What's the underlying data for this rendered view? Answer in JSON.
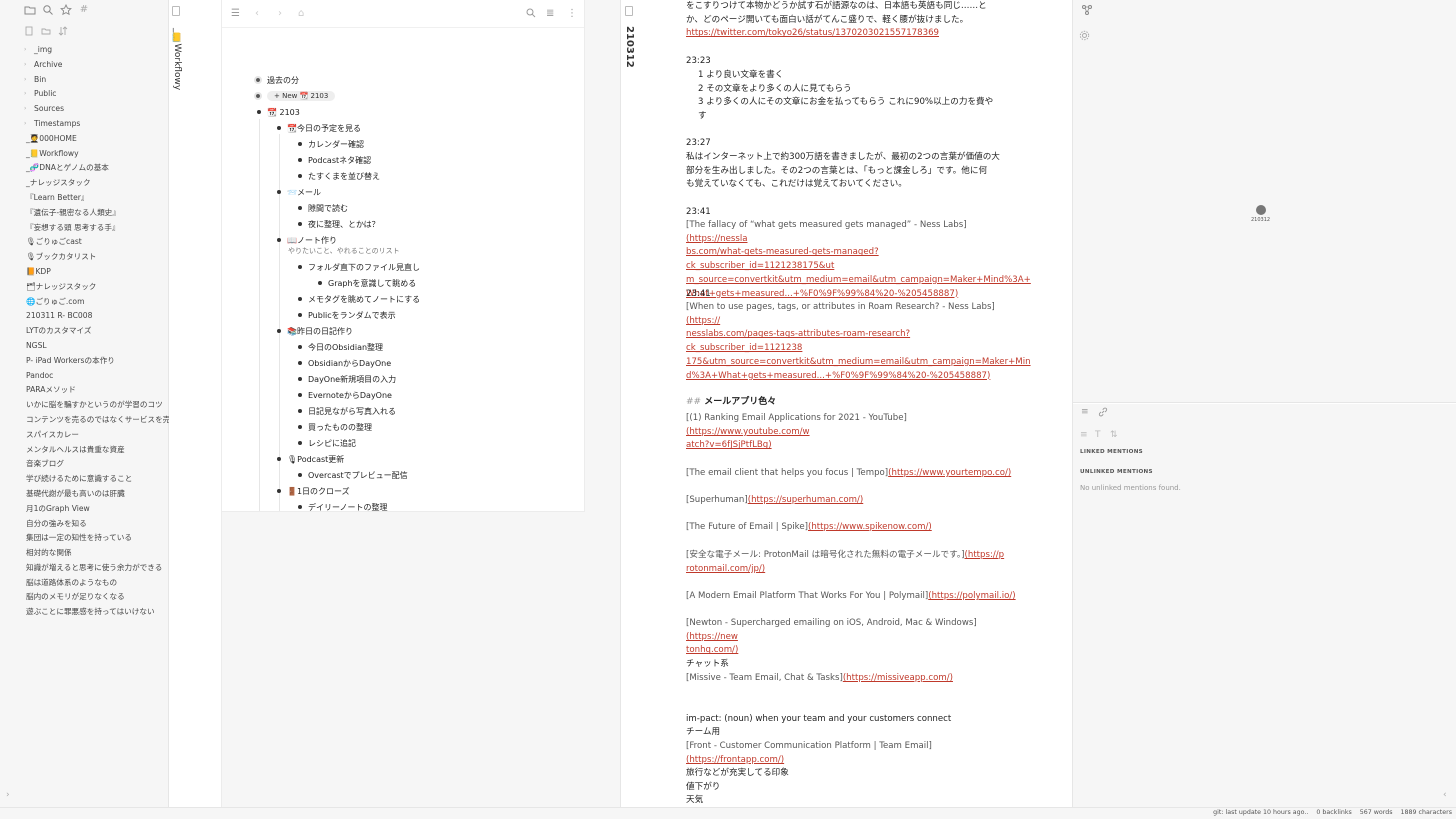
{
  "sidebar": {
    "toolbar_icons": [
      "folder-icon",
      "search-icon",
      "star-icon",
      "tag-icon"
    ],
    "files": [
      {
        "label": "_img",
        "folder": true
      },
      {
        "label": "Archive",
        "folder": true
      },
      {
        "label": "Bin",
        "folder": true
      },
      {
        "label": "Public",
        "folder": true
      },
      {
        "label": "Sources",
        "folder": true
      },
      {
        "label": "Timestamps",
        "folder": true
      },
      {
        "label": "_🧑‍🎓000HOME",
        "folder": false
      },
      {
        "label": "_📒Workflowy",
        "folder": false
      },
      {
        "label": "_🧬DNAとゲノムの基本",
        "folder": false
      },
      {
        "label": "_ナレッジスタック",
        "folder": false
      },
      {
        "label": "『Learn Better』",
        "folder": false
      },
      {
        "label": "『遺伝子-親密なる人類史』",
        "folder": false
      },
      {
        "label": "『妄想する頭 思考する手』",
        "folder": false
      },
      {
        "label": "🎙ごりゅごcast",
        "folder": false
      },
      {
        "label": "🎙ブックカタリスト",
        "folder": false
      },
      {
        "label": "📙KDP",
        "folder": false
      },
      {
        "label": "🗂ナレッジスタック",
        "folder": false
      },
      {
        "label": "🌐ごりゅご.com",
        "folder": false
      },
      {
        "label": "210311 R- BC008",
        "folder": false
      },
      {
        "label": "LYTのカスタマイズ",
        "folder": false
      },
      {
        "label": "NGSL",
        "folder": false
      },
      {
        "label": "P- iPad Workersの本作り",
        "folder": false
      },
      {
        "label": "Pandoc",
        "folder": false
      },
      {
        "label": "PARAメソッド",
        "folder": false
      },
      {
        "label": "いかに脳を騙すかというのが学習のコツ",
        "folder": false
      },
      {
        "label": "コンテンツを売るのではなくサービスを売る",
        "folder": false
      },
      {
        "label": "スパイスカレー",
        "folder": false
      },
      {
        "label": "メンタルヘルスは貴重な資産",
        "folder": false
      },
      {
        "label": "音楽ブログ",
        "folder": false
      },
      {
        "label": "学び続けるために意識すること",
        "folder": false
      },
      {
        "label": "基礎代謝が最も高いのは肝臓",
        "folder": false
      },
      {
        "label": "月1のGraph View",
        "folder": false
      },
      {
        "label": "自分の強みを知る",
        "folder": false
      },
      {
        "label": "集団は一定の知性を持っている",
        "folder": false
      },
      {
        "label": "相対的な関係",
        "folder": false
      },
      {
        "label": "知識が増えると思考に使う余力ができる",
        "folder": false
      },
      {
        "label": "脳は道路体系のようなもの",
        "folder": false
      },
      {
        "label": "脳内のメモリが足りなくなる",
        "folder": false
      },
      {
        "label": "遊ぶことに罪悪感を持ってはいけない",
        "folder": false
      }
    ]
  },
  "ribbon_title": "_📒Workflowy",
  "outliner": {
    "root1": "過去の分",
    "new_button": "+ New 📆 2103",
    "root2": "📆 2103",
    "items": [
      {
        "text": "📆今日の予定を見る",
        "level": 1
      },
      {
        "text": "カレンダー確認",
        "level": 2
      },
      {
        "text": "Podcastネタ確認",
        "level": 2
      },
      {
        "text": "たすくまを並び替え",
        "level": 2
      },
      {
        "text": "📨メール",
        "level": 1
      },
      {
        "text": "隙間で読む",
        "level": 2
      },
      {
        "text": "夜に整理、とかは？",
        "level": 2
      },
      {
        "text": "📖ノート作り",
        "level": 1,
        "note": "やりたいこと、やれることのリスト"
      },
      {
        "text": "フォルダ直下のファイル見直し",
        "level": 2
      },
      {
        "text": "Graphを意識して眺める",
        "level": 3
      },
      {
        "text": "メモタグを眺めてノートにする",
        "level": 2
      },
      {
        "text": "Publicをランダムで表示",
        "level": 2
      },
      {
        "text": "📚昨日の日記作り",
        "level": 1
      },
      {
        "text": "今日のObsidian整理",
        "level": 2
      },
      {
        "text": "ObsidianからDayOne",
        "level": 2
      },
      {
        "text": "DayOne新規項目の入力",
        "level": 2
      },
      {
        "text": "EvernoteからDayOne",
        "level": 2
      },
      {
        "text": "日記見ながら写真入れる",
        "level": 2
      },
      {
        "text": "買ったものの整理",
        "level": 2
      },
      {
        "text": "レシピに追記",
        "level": 2
      },
      {
        "text": "🎙Podcast更新",
        "level": 1
      },
      {
        "text": "Overcastでプレビュー配信",
        "level": 2
      },
      {
        "text": "🚪1日のクローズ",
        "level": 1
      },
      {
        "text": "デイリーノートの整理",
        "level": 2
      }
    ]
  },
  "note": {
    "title": "210312",
    "p1_line1": "をこすりつけて本物かどうか試す石が語源なのは、日本語も英語も同じ……と",
    "p1_line2": "か、どのページ開いても面白い話がてんこ盛りで、軽く腰が抜けました。",
    "p1_link": "https://twitter.com/tokyo26/status/1370203021557178369",
    "t1": "23:23",
    "list1": [
      "1 より良い文章を書く",
      "2 その文章をより多くの人に見てもらう",
      "3 より多くの人にその文章にお金を払ってもらう これに90%以上の力を費や",
      "す"
    ],
    "t2": "23:27",
    "p2": [
      "私はインターネット上で約300万語を書きましたが、最初の2つの言葉が価値の大",
      "部分を生み出しました。その2つの言葉とは、「もっと課金しろ」です。他に何",
      "も覚えていなくても、これだけは覚えておいてください。"
    ],
    "t3": "23:41",
    "p3_text": "[The fallacy of “what gets measured gets managed” - Ness Labs]",
    "p3_link": [
      "(https://nessla",
      "bs.com/what-gets-measured-gets-managed?ck_subscriber_id=1121238175&ut",
      "m_source=convertkit&utm_medium=email&utm_campaign=Maker+Mind%3A+",
      "What+gets+measured...+%F0%9F%99%84%20-%205458887)"
    ],
    "t4": "23:41",
    "p4_text": "[When to use pages, tags, or attributes in Roam Research? - Ness Labs]",
    "p4_link": [
      "(https://",
      "nesslabs.com/pages-tags-attributes-roam-research?ck_subscriber_id=1121238",
      "175&utm_source=convertkit&utm_medium=email&utm_campaign=Maker+Min",
      "d%3A+What+gets+measured...+%F0%9F%99%84%20-%205458887)"
    ],
    "heading_marker": "##",
    "heading": "メールアプリ色々",
    "yt_text": "[(1) Ranking Email Applications for 2021 - YouTube]",
    "yt_link1": "(https://www.youtube.com/w",
    "yt_link2": "atch?v=6fJSjPtfLBg)",
    "tempo_text": "[The email client that helps you focus | Tempo]",
    "tempo_link": "(https://www.yourtempo.co/)",
    "superhuman_text": "[Superhuman]",
    "superhuman_link": "(https://superhuman.com/)",
    "spike_text": "[The Future of Email | Spike]",
    "spike_link": "(https://www.spikenow.com/)",
    "proton_text": "[安全な電子メール: ProtonMail は暗号化された無料の電子メールです。]",
    "proton_link1": "(https://p",
    "proton_link2": "rotonmail.com/jp/)",
    "polymail_text": "[A Modern Email Platform That Works For You | Polymail]",
    "polymail_link": "(https://polymail.io/)",
    "newton_text": "[Newton - Supercharged emailing on iOS, Android, Mac & Windows]",
    "newton_link1": "(https://new",
    "newton_link2": "tonhq.com/)",
    "chat_heading": "チャット系",
    "missive_text": "[Missive - Team Email, Chat & Tasks]",
    "missive_link": "(https://missiveapp.com/)",
    "impact": "im-pact: (noun) when your team and your customers connect",
    "team": "チーム用",
    "front_text": "[Front - Customer Communication Platform | Team Email]",
    "front_link": "(https://frontapp.com/)",
    "travel": "旅行などが充実してる印象",
    "price": "値下がり",
    "weather": "天気"
  },
  "graph": {
    "node_label": "210312"
  },
  "backlinks": {
    "linked_heading": "LINKED MENTIONS",
    "unlinked_heading": "UNLINKED MENTIONS",
    "empty_text": "No unlinked mentions found."
  },
  "status": {
    "git": "git: last update 10 hours ago..",
    "backlinks": "0 backlinks",
    "words": "567 words",
    "characters": "1889 characters"
  }
}
